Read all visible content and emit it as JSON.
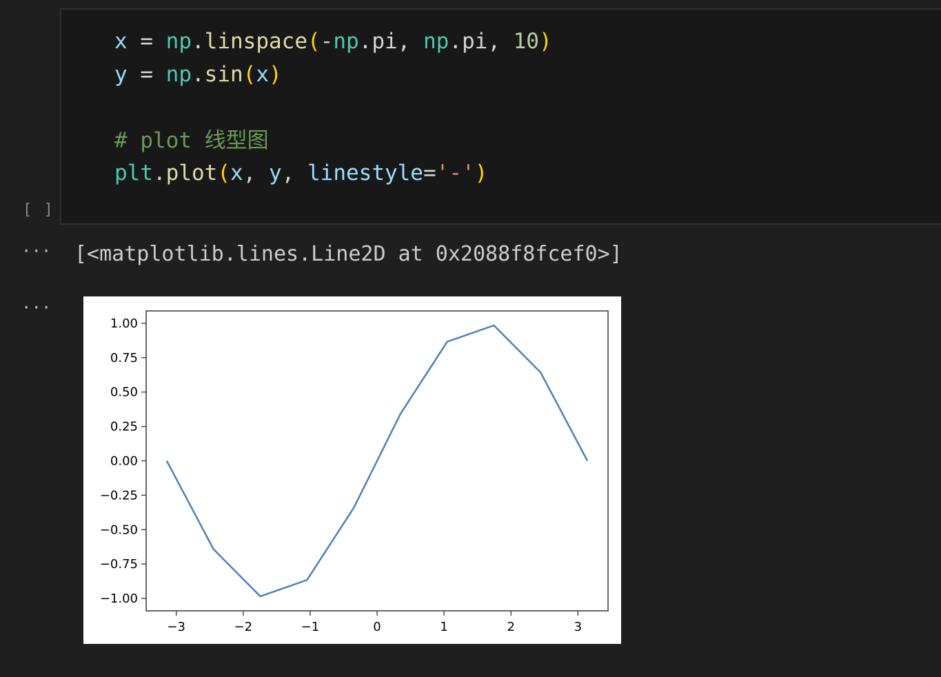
{
  "code_cell": {
    "execution_count": "[ ]",
    "lines": {
      "l1": {
        "var": "x",
        "eq": " = ",
        "mod1": "np",
        "dot1": ".",
        "fn": "linspace",
        "open": "(",
        "minus": "-",
        "mod2": "np",
        "dot2": ".",
        "attr1": "pi",
        "comma1": ", ",
        "mod3": "np",
        "dot3": ".",
        "attr2": "pi",
        "comma2": ", ",
        "num": "10",
        "close": ")"
      },
      "l2": {
        "var": "y",
        "eq": " = ",
        "mod": "np",
        "dot": ".",
        "fn": "sin",
        "open": "(",
        "arg": "x",
        "close": ")"
      },
      "l3": {
        "comment": "# plot 线型图"
      },
      "l4": {
        "mod": "plt",
        "dot": ".",
        "fn": "plot",
        "open": "(",
        "a1": "x",
        "c1": ", ",
        "a2": "y",
        "c2": ", ",
        "kw": "linestyle",
        "eq": "=",
        "str": "'-'",
        "close": ")"
      }
    }
  },
  "outputs": {
    "ellipsis_1": "···",
    "ellipsis_2": "···",
    "text_output": "[<matplotlib.lines.Line2D at 0x2088f8fcef0>]"
  },
  "chart_data": {
    "type": "line",
    "title": "",
    "xlabel": "",
    "ylabel": "",
    "xlim": [
      -3.45,
      3.45
    ],
    "ylim": [
      -1.09,
      1.09
    ],
    "x_ticks": [
      -3,
      -2,
      -1,
      0,
      1,
      2,
      3
    ],
    "x_tick_labels": [
      "−3",
      "−2",
      "−1",
      "0",
      "1",
      "2",
      "3"
    ],
    "y_ticks": [
      1.0,
      0.75,
      0.5,
      0.25,
      0.0,
      -0.25,
      -0.5,
      -0.75,
      -1.0
    ],
    "y_tick_labels": [
      "1.00",
      "0.75",
      "0.50",
      "0.25",
      "0.00",
      "−0.25",
      "−0.50",
      "−0.75",
      "−1.00"
    ],
    "grid": false,
    "line_color": "#4c7fb8",
    "series": [
      {
        "x": [
          -3.142,
          -2.443,
          -1.745,
          -1.047,
          -0.349,
          0.349,
          1.047,
          1.745,
          2.443,
          3.142
        ],
        "y": [
          0.0,
          -0.643,
          -0.985,
          -0.866,
          -0.342,
          0.342,
          0.866,
          0.985,
          0.643,
          0.0
        ]
      }
    ]
  }
}
